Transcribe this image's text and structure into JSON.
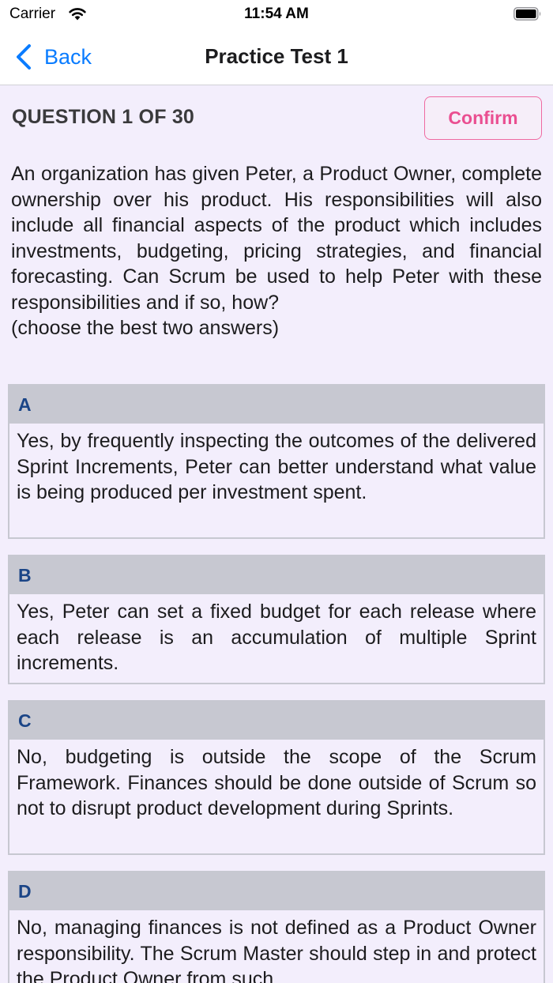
{
  "status_bar": {
    "carrier": "Carrier",
    "time": "11:54 AM",
    "wifi_icon": "wifi-icon",
    "battery_icon": "battery-icon"
  },
  "nav": {
    "back_label": "Back",
    "back_icon": "chevron-left-icon",
    "title": "Practice Test 1"
  },
  "question": {
    "header": "QUESTION 1 OF 30",
    "confirm_label": "Confirm",
    "text": "An organization has given Peter, a Product Owner, complete ownership over his product. His responsibilities will also include all financial aspects of the product which includes investments, budgeting, pricing strategies, and financial forecasting. Can Scrum be used to help Peter with these responsibilities and if so, how?",
    "hint": "(choose the best two answers)"
  },
  "options": [
    {
      "letter": "A",
      "text": "Yes, by frequently inspecting the outcomes of the delivered Sprint Increments, Peter can better understand what value is being produced per investment spent."
    },
    {
      "letter": "B",
      "text": "Yes, Peter can set a fixed budget for each release where each release is an accumulation of multiple Sprint increments."
    },
    {
      "letter": "C",
      "text": "No, budgeting is outside the scope of the Scrum Framework. Finances should be done outside of Scrum so not to disrupt product development during Sprints."
    },
    {
      "letter": "D",
      "text": "No, managing finances is not defined as a Product Owner responsibility. The Scrum Master should step in and protect the Product Owner from such"
    }
  ],
  "colors": {
    "background": "#f3eefc",
    "accent_blue": "#0a7cff",
    "confirm_pink": "#ea4f91",
    "option_header": "#c7c8d1",
    "option_letter": "#1b4587"
  }
}
